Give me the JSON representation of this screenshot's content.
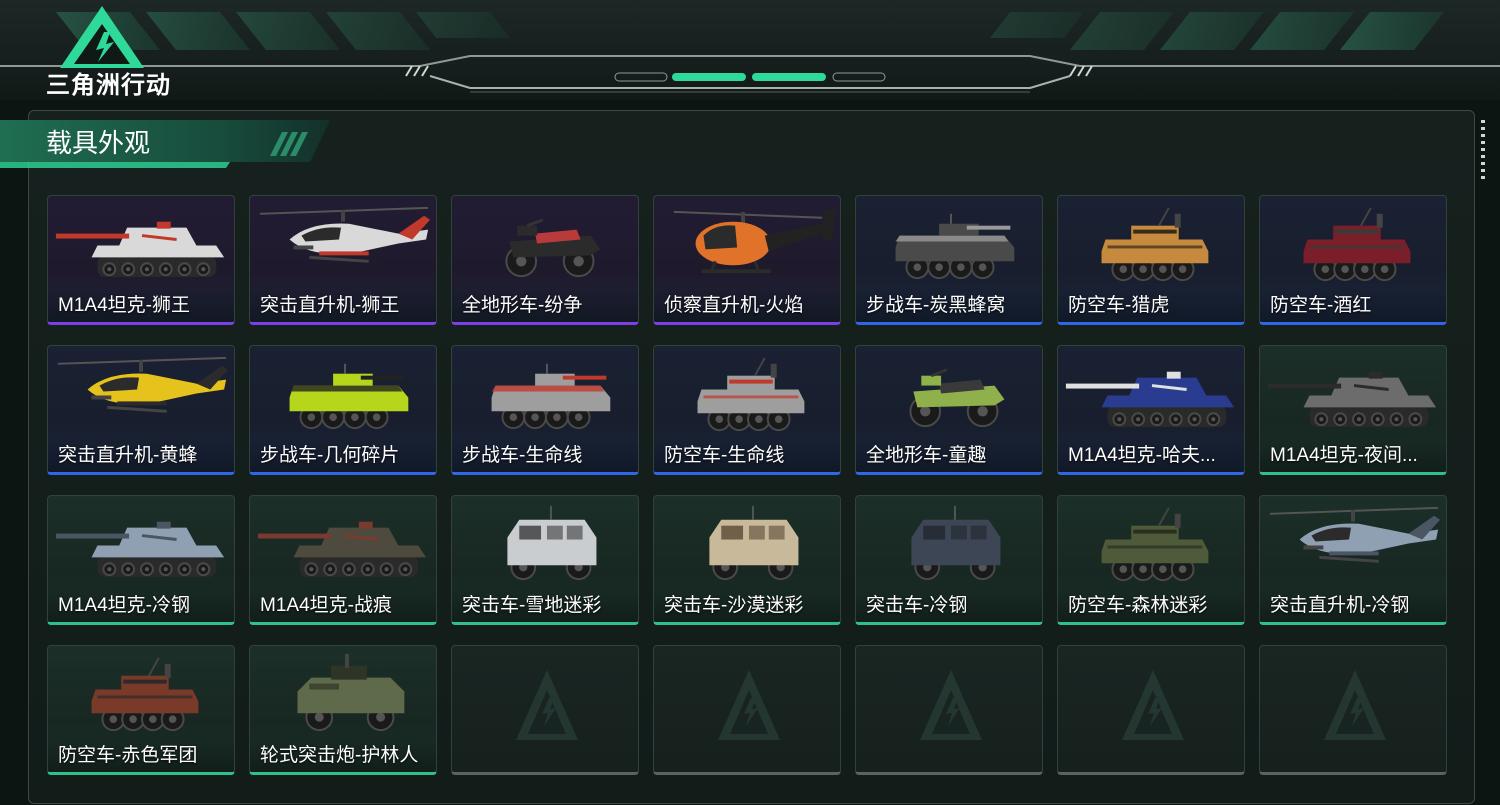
{
  "app": {
    "logo_text": "三角洲行动"
  },
  "colors": {
    "purple": "#7d3fe6",
    "blue": "#2f67e8",
    "green": "#2ec18a",
    "empty": "#5b6360",
    "accent": "#2ed99a"
  },
  "section": {
    "title": "载具外观"
  },
  "skins": [
    {
      "name": "M1A4坦克-狮王",
      "rarity": "purple",
      "vehicle": "tank-icon",
      "body": "#d9d9d9",
      "accent": "#c0392b"
    },
    {
      "name": "突击直升机-狮王",
      "rarity": "purple",
      "vehicle": "attack-helicopter-icon",
      "body": "#d9d9d9",
      "accent": "#c0392b"
    },
    {
      "name": "全地形车-纷争",
      "rarity": "purple",
      "vehicle": "atv-icon",
      "body": "#2b2b2b",
      "accent": "#b83a3a"
    },
    {
      "name": "侦察直升机-火焰",
      "rarity": "purple",
      "vehicle": "scout-helicopter-icon",
      "body": "#e0722a",
      "accent": "#222222"
    },
    {
      "name": "步战车-炭黑蜂窝",
      "rarity": "blue",
      "vehicle": "ifv-icon",
      "body": "#4a4a4a",
      "accent": "#9a9a9a"
    },
    {
      "name": "防空车-猎虎",
      "rarity": "blue",
      "vehicle": "aa-vehicle-icon",
      "body": "#c58a3d",
      "accent": "#3a2a1a"
    },
    {
      "name": "防空车-酒红",
      "rarity": "blue",
      "vehicle": "aa-vehicle-icon",
      "body": "#7a1f2a",
      "accent": "#3a3a3a"
    },
    {
      "name": "突击直升机-黄蜂",
      "rarity": "blue",
      "vehicle": "attack-helicopter-icon",
      "body": "#e6c21c",
      "accent": "#2b2b2b"
    },
    {
      "name": "步战车-几何碎片",
      "rarity": "blue",
      "vehicle": "ifv-icon",
      "body": "#b6d61c",
      "accent": "#222222"
    },
    {
      "name": "步战车-生命线",
      "rarity": "blue",
      "vehicle": "ifv-icon",
      "body": "#9e9e9e",
      "accent": "#c0392b"
    },
    {
      "name": "防空车-生命线",
      "rarity": "blue",
      "vehicle": "aa-vehicle-icon",
      "body": "#9e9e9e",
      "accent": "#c0392b"
    },
    {
      "name": "全地形车-童趣",
      "rarity": "blue",
      "vehicle": "atv-icon",
      "body": "#8fb04a",
      "accent": "#3a3a3a"
    },
    {
      "name": "M1A4坦克-哈夫...",
      "rarity": "blue",
      "vehicle": "tank-icon",
      "body": "#2a3c8f",
      "accent": "#e0e0e0"
    },
    {
      "name": "M1A4坦克-夜间...",
      "rarity": "green",
      "vehicle": "tank-icon",
      "body": "#6c6c6c",
      "accent": "#2b2b2b"
    },
    {
      "name": "M1A4坦克-冷钢",
      "rarity": "green",
      "vehicle": "tank-icon",
      "body": "#8fa0b3",
      "accent": "#4a5664"
    },
    {
      "name": "M1A4坦克-战痕",
      "rarity": "green",
      "vehicle": "tank-icon",
      "body": "#4e4a3e",
      "accent": "#7a3a30"
    },
    {
      "name": "突击车-雪地迷彩",
      "rarity": "green",
      "vehicle": "assault-vehicle-icon",
      "body": "#c9cdd0",
      "accent": "#3a3a3a"
    },
    {
      "name": "突击车-沙漠迷彩",
      "rarity": "green",
      "vehicle": "assault-vehicle-icon",
      "body": "#c7b99a",
      "accent": "#5a4a35"
    },
    {
      "name": "突击车-冷钢",
      "rarity": "green",
      "vehicle": "assault-vehicle-icon",
      "body": "#3c4654",
      "accent": "#22272e"
    },
    {
      "name": "防空车-森林迷彩",
      "rarity": "green",
      "vehicle": "aa-vehicle-icon",
      "body": "#4f5a3a",
      "accent": "#2a2f22"
    },
    {
      "name": "突击直升机-冷钢",
      "rarity": "green",
      "vehicle": "attack-helicopter-icon",
      "body": "#8fa0b3",
      "accent": "#4a5664"
    },
    {
      "name": "防空车-赤色军团",
      "rarity": "green",
      "vehicle": "aa-vehicle-icon",
      "body": "#7a3a2a",
      "accent": "#2b2b2b"
    },
    {
      "name": "轮式突击炮-护林人",
      "rarity": "green",
      "vehicle": "wheeled-assault-gun-icon",
      "body": "#5e6a4a",
      "accent": "#2f3526"
    },
    {
      "name": "",
      "rarity": "empty",
      "vehicle": "placeholder-logo-icon"
    },
    {
      "name": "",
      "rarity": "empty",
      "vehicle": "placeholder-logo-icon"
    },
    {
      "name": "",
      "rarity": "empty",
      "vehicle": "placeholder-logo-icon"
    },
    {
      "name": "",
      "rarity": "empty",
      "vehicle": "placeholder-logo-icon"
    },
    {
      "name": "",
      "rarity": "empty",
      "vehicle": "placeholder-logo-icon"
    }
  ]
}
